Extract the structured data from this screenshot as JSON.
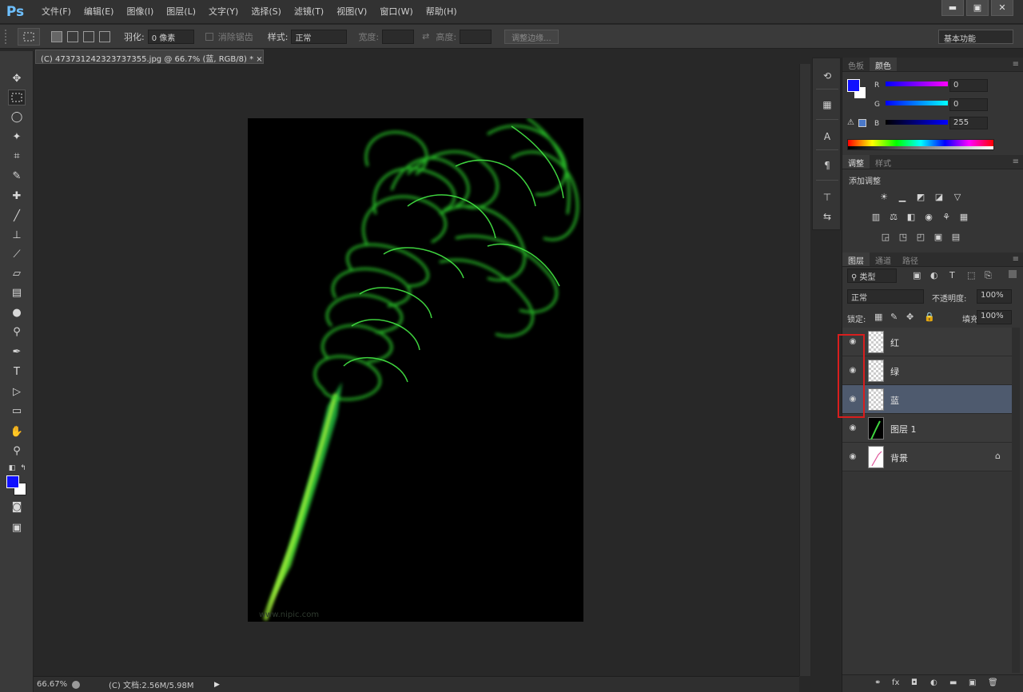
{
  "app": {
    "logo": "Ps"
  },
  "menu": [
    "文件(F)",
    "编辑(E)",
    "图像(I)",
    "图层(L)",
    "文字(Y)",
    "选择(S)",
    "滤镜(T)",
    "视图(V)",
    "窗口(W)",
    "帮助(H)"
  ],
  "window_controls": {
    "minimize": "▬",
    "maximize": "▣",
    "close": "✕"
  },
  "options_bar": {
    "feather_label": "羽化:",
    "feather_value": "0 像素",
    "antialias_label": "消除锯齿",
    "style_label": "样式:",
    "style_value": "正常",
    "width_label": "宽度:",
    "height_label": "高度:",
    "refine_edge": "调整边缘...",
    "workspace": "基本功能"
  },
  "document": {
    "tab_title": "(C) 473731242323737355.jpg @ 66.7% (蓝, RGB/8) * ×",
    "watermark": "www.nipic.com"
  },
  "status_bar": {
    "zoom": "66.67%",
    "doc_info": "(C) 文档:2.56M/5.98M",
    "arrow": "▶"
  },
  "color_panel": {
    "tabs": [
      "色板",
      "颜色"
    ],
    "active_tab": "颜色",
    "channels": [
      {
        "label": "R",
        "value": "0",
        "gradient": "linear-gradient(to right, #0000ff, #ff00ff)"
      },
      {
        "label": "G",
        "value": "0",
        "gradient": "linear-gradient(to right, #0000ff, #00ffff)"
      },
      {
        "label": "B",
        "value": "255",
        "gradient": "linear-gradient(to right, #000000, #0000ff)"
      }
    ],
    "foreground": "#1010ff",
    "background": "#ffffff"
  },
  "adjustments_panel": {
    "tabs": [
      "调整",
      "样式"
    ],
    "active_tab": "调整",
    "title": "添加调整"
  },
  "layers_panel": {
    "tabs": [
      "图层",
      "通道",
      "路径"
    ],
    "active_tab": "图层",
    "filter_kind": "类型",
    "blend_mode": "正常",
    "opacity_label": "不透明度:",
    "opacity_value": "100%",
    "lock_label": "锁定:",
    "fill_label": "填充:",
    "fill_value": "100%",
    "layers": [
      {
        "name": "红",
        "thumb": "transparent",
        "visible": true,
        "selected": false
      },
      {
        "name": "绿",
        "thumb": "transparent",
        "visible": true,
        "selected": false
      },
      {
        "name": "蓝",
        "thumb": "transparent",
        "visible": true,
        "selected": true
      },
      {
        "name": "图层 1",
        "thumb": "dark",
        "visible": true,
        "selected": false
      },
      {
        "name": "背景",
        "thumb": "white",
        "visible": true,
        "selected": false,
        "locked": true
      }
    ]
  },
  "colors": {
    "accent_highlight": "#d81e1e",
    "selected_layer": "#4e5a6e",
    "smoke": "#2fd62f"
  }
}
